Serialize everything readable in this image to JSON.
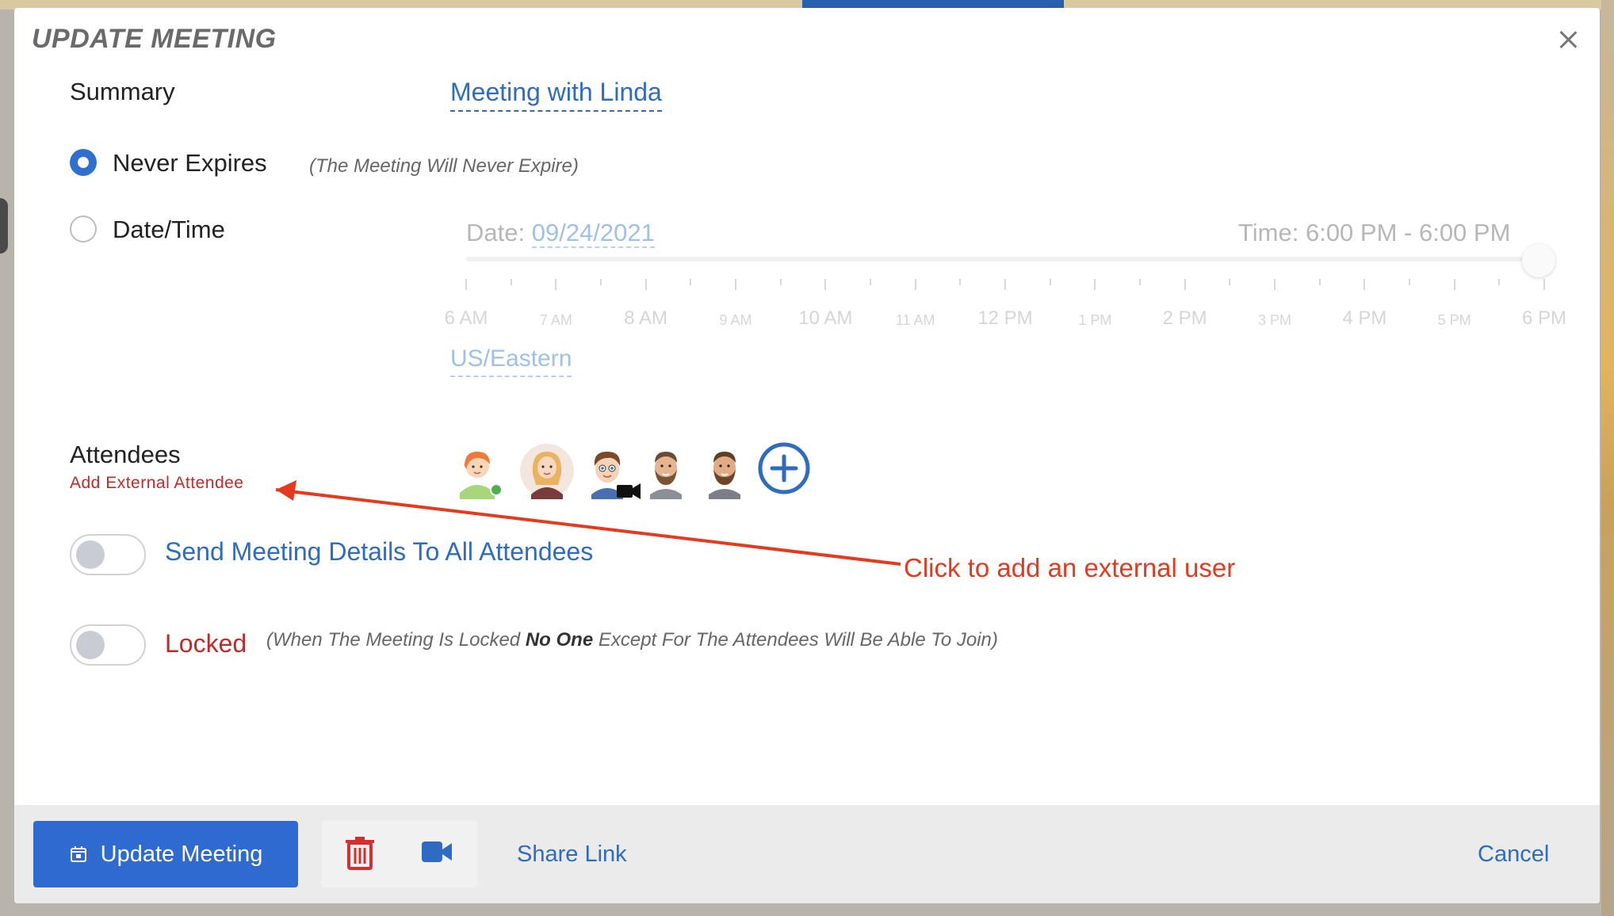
{
  "dialog": {
    "title": "UPDATE MEETING"
  },
  "summary": {
    "label": "Summary",
    "value": "Meeting with Linda"
  },
  "expiry": {
    "never_label": "Never Expires",
    "never_hint": "(The Meeting Will Never Expire)",
    "never_selected": true,
    "datetime_label": "Date/Time",
    "datetime_selected": false
  },
  "schedule": {
    "date_prefix": "Date: ",
    "date_value": "09/24/2021",
    "time_text": "Time: 6:00 PM - 6:00 PM",
    "slider_value_label": "6 PM",
    "ticks": [
      "6 AM",
      "7 AM",
      "8 AM",
      "9 AM",
      "10 AM",
      "11 AM",
      "12 PM",
      "1 PM",
      "2 PM",
      "3 PM",
      "4 PM",
      "5 PM",
      "6 PM"
    ],
    "timezone": "US/Eastern"
  },
  "attendees": {
    "label": "Attendees",
    "add_external": "Add External Attendee",
    "avatars": [
      "avatar-redhead-online",
      "avatar-blonde-woman",
      "avatar-brown-hair-man-video",
      "avatar-bearded-man",
      "avatar-bearded-man-2"
    ]
  },
  "toggles": {
    "send_details_label": "Send Meeting Details To All Attendees",
    "send_details_on": false,
    "locked_label": "Locked",
    "locked_on": false,
    "locked_hint_pre": "(When The Meeting Is Locked ",
    "locked_hint_bold": "No One",
    "locked_hint_post": " Except For The Attendees Will Be Able To Join)"
  },
  "annotation": {
    "text": "Click to add an external user"
  },
  "footer": {
    "update_label": "Update Meeting",
    "share_link": "Share Link",
    "cancel": "Cancel"
  },
  "colors": {
    "primary": "#2f6ad0",
    "link": "#2d6cc0",
    "danger": "#c62828",
    "annotation": "#e53a1e"
  },
  "icons": [
    "close-icon",
    "calendar-icon",
    "trash-icon",
    "video-camera-icon",
    "add-circle-icon"
  ]
}
